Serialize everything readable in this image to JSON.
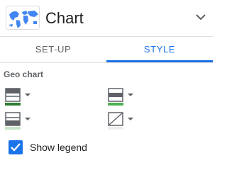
{
  "header": {
    "title": "Chart",
    "thumbnail_icon": "world-map-icon",
    "collapse_icon": "chevron-down-icon"
  },
  "tabs": [
    {
      "label": "SET-UP",
      "active": false
    },
    {
      "label": "STYLE",
      "active": true
    }
  ],
  "section": {
    "title": "Geo chart"
  },
  "color_pickers": [
    {
      "name": "max-color",
      "icon": "color-scale-icon",
      "color": "#2e7d32"
    },
    {
      "name": "mid-color",
      "icon": "color-scale-icon",
      "color": "#4caf50"
    },
    {
      "name": "min-color",
      "icon": "color-scale-icon",
      "color": "#c8e6c9"
    },
    {
      "name": "no-data-color",
      "icon": "no-fill-icon",
      "color": "#eeeeee"
    }
  ],
  "legend": {
    "label": "Show legend",
    "checked": true
  },
  "colors": {
    "accent": "#1a73e8",
    "text": "#202124",
    "muted": "#5f6368"
  }
}
